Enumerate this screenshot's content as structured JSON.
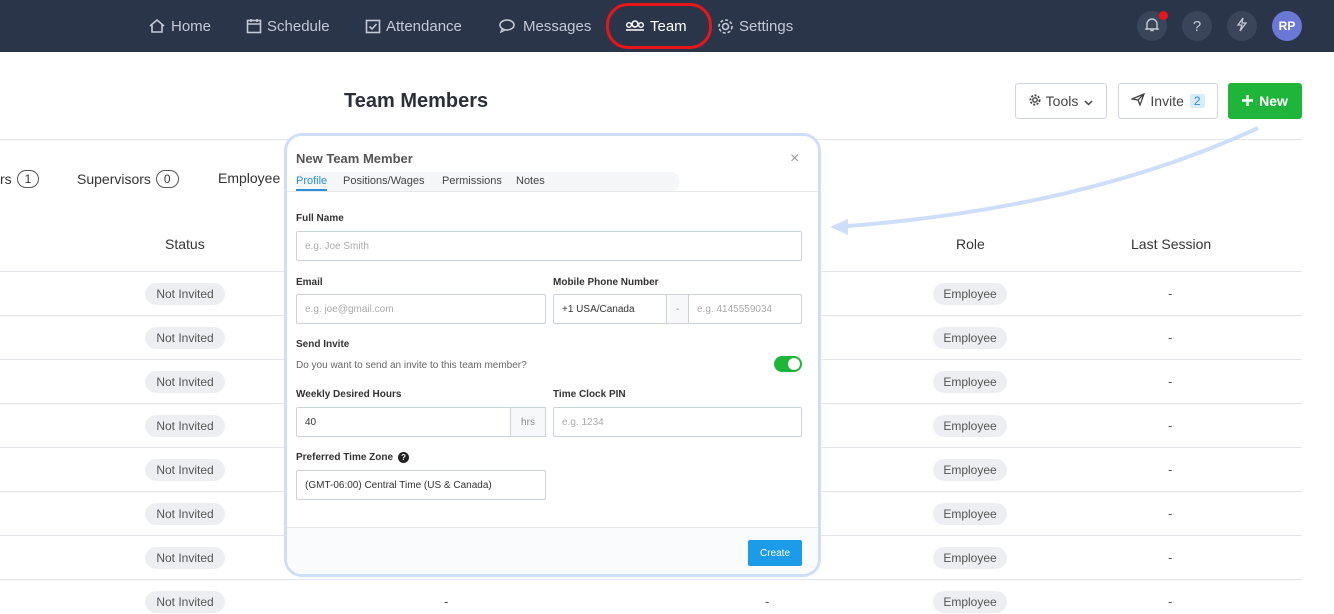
{
  "nav": {
    "items": [
      {
        "label": "Home",
        "icon": "home-icon"
      },
      {
        "label": "Schedule",
        "icon": "calendar-icon"
      },
      {
        "label": "Attendance",
        "icon": "checkbox-icon"
      },
      {
        "label": "Messages",
        "icon": "chat-icon"
      },
      {
        "label": "Team",
        "icon": "team-icon"
      },
      {
        "label": "Settings",
        "icon": "gear-icon"
      }
    ],
    "help_glyph": "?",
    "avatar_initials": "RP"
  },
  "page": {
    "title": "Team Members",
    "tools_label": "Tools",
    "invite_label": "Invite",
    "invite_count": "2",
    "new_label": "New"
  },
  "filters": [
    {
      "label": "rs",
      "count": "1"
    },
    {
      "label": "Supervisors",
      "count": "0"
    },
    {
      "label": "Employee",
      "count": ""
    }
  ],
  "table": {
    "headers": {
      "status": "Status",
      "role": "Role",
      "last_session": "Last Session"
    },
    "rows": [
      {
        "status": "Not Invited",
        "role": "Employee",
        "last": "-"
      },
      {
        "status": "Not Invited",
        "role": "Employee",
        "last": "-"
      },
      {
        "status": "Not Invited",
        "role": "Employee",
        "last": "-"
      },
      {
        "status": "Not Invited",
        "role": "Employee",
        "last": "-"
      },
      {
        "status": "Not Invited",
        "role": "Employee",
        "last": "-"
      },
      {
        "status": "Not Invited",
        "role": "Employee",
        "last": "-"
      },
      {
        "status": "Not Invited",
        "role": "Employee",
        "last": "-"
      },
      {
        "status": "Not Invited",
        "role": "Employee",
        "last": "-",
        "col3": "-",
        "col4": "-"
      }
    ]
  },
  "modal": {
    "title": "New Team Member",
    "close": "×",
    "tabs": [
      "Profile",
      "Positions/Wages",
      "Permissions",
      "Notes"
    ],
    "full_name_label": "Full Name",
    "full_name_placeholder": "e.g. Joe Smith",
    "email_label": "Email",
    "email_placeholder": "e.g. joe@gmail.com",
    "phone_label": "Mobile Phone Number",
    "phone_country": "+1 USA/Canada",
    "phone_sep": "-",
    "phone_placeholder": "e.g. 4145559034",
    "send_invite_label": "Send Invite",
    "send_invite_question": "Do you want to send an invite to this team member?",
    "send_invite_on": true,
    "weekly_hours_label": "Weekly Desired Hours",
    "weekly_hours_value": "40",
    "weekly_hours_unit": "hrs",
    "pin_label": "Time Clock PIN",
    "pin_placeholder": "e.g. 1234",
    "timezone_label": "Preferred Time Zone",
    "timezone_help": "?",
    "timezone_value": "(GMT-06:00) Central Time (US & Canada)",
    "create_label": "Create"
  },
  "colors": {
    "nav_bg": "#2b3549",
    "accent_green": "#1fb53a",
    "accent_blue": "#1b9be8",
    "annotation_red": "#e8161b"
  }
}
